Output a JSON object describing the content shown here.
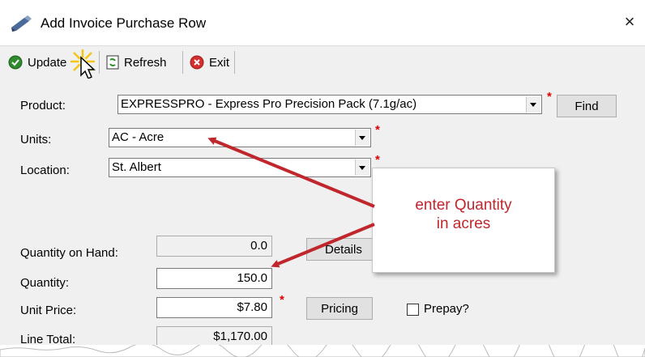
{
  "window": {
    "title": "Add Invoice Purchase Row",
    "close_glyph": "×"
  },
  "toolbar": {
    "update_label": "Update",
    "refresh_label": "Refresh",
    "exit_label": "Exit"
  },
  "form": {
    "product_label": "Product:",
    "product_value": "EXPRESSPRO - Express Pro Precision Pack (7.1g/ac)",
    "find_label": "Find",
    "units_label": "Units:",
    "units_value": "AC - Acre",
    "location_label": "Location:",
    "location_value": "St. Albert",
    "qoh_label": "Quantity on Hand:",
    "qoh_value": "0.0",
    "details_label": "Details",
    "quantity_label": "Quantity:",
    "quantity_value": "150.0",
    "unit_price_label": "Unit Price:",
    "unit_price_value": "$7.80",
    "pricing_label": "Pricing",
    "prepay_label": "Prepay?",
    "line_total_label": "Line Total:",
    "line_total_value": "$1,170.00",
    "required_marker": "*"
  },
  "callout": {
    "line1": "enter Quantity",
    "line2": "in acres"
  },
  "colors": {
    "annotation_red": "#c0272d",
    "required_red": "#e00000",
    "toolbar_bg": "#f0f0f0"
  }
}
